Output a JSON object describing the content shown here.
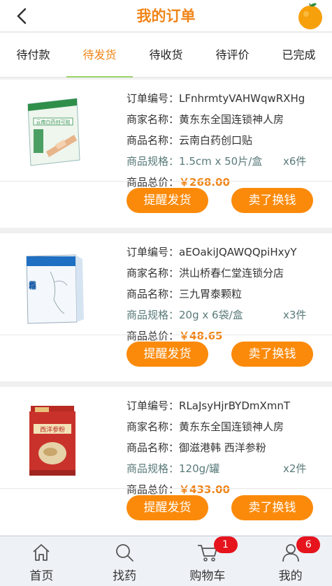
{
  "header": {
    "title": "我的订单"
  },
  "tabs": [
    {
      "label": "待付款",
      "active": false
    },
    {
      "label": "待发货",
      "active": true
    },
    {
      "label": "待收货",
      "active": false
    },
    {
      "label": "待评价",
      "active": false
    },
    {
      "label": "已完成",
      "active": false
    }
  ],
  "labels": {
    "order_no": "订单编号：",
    "merchant": "商家名称：",
    "product": "商品名称：",
    "spec": "商品规格：",
    "total": "商品总价：",
    "remind_button": "提醒发货",
    "sell_button": "卖了换钱"
  },
  "orders": [
    {
      "order_no": "LFnhrmtyVAHWqwRXHg",
      "merchant": "黄东东全国连锁神人房",
      "product": "云南白药创口贴",
      "spec": "1.5cm x 50片/盒",
      "quantity": "x6件",
      "price": "￥268.00",
      "image_icon": "band-aid-box",
      "box_text": "云南白药创可贴"
    },
    {
      "order_no": "aEOakiJQAWQQpiHxyY",
      "merchant": "洪山桥春仁堂连锁分店",
      "product": "三九胃泰颗粒",
      "spec": "20g x 6袋/盒",
      "quantity": "x3件",
      "price": "￥48.65",
      "image_icon": "medicine-granule-box",
      "box_text": "三九胃泰颗粒"
    },
    {
      "order_no": "RLaJsyHjrBYDmXmnT",
      "merchant": "黄东东全国连锁神人房",
      "product": "御滋港韩 西洋参粉",
      "spec": "120g/罐",
      "quantity": "x2件",
      "price": "￥433.00",
      "image_icon": "ginseng-powder-can",
      "box_text": "西洋参粉"
    }
  ],
  "bottom_nav": [
    {
      "label": "首页",
      "icon": "home-icon",
      "badge": ""
    },
    {
      "label": "找药",
      "icon": "search-icon",
      "badge": ""
    },
    {
      "label": "购物车",
      "icon": "cart-icon",
      "badge": "1"
    },
    {
      "label": "我的",
      "icon": "user-icon",
      "badge": "6"
    }
  ],
  "colors": {
    "accent": "#f08519",
    "button": "#fb8a0b",
    "badge": "#e5141d",
    "tab_underline": "#9bd26a"
  }
}
